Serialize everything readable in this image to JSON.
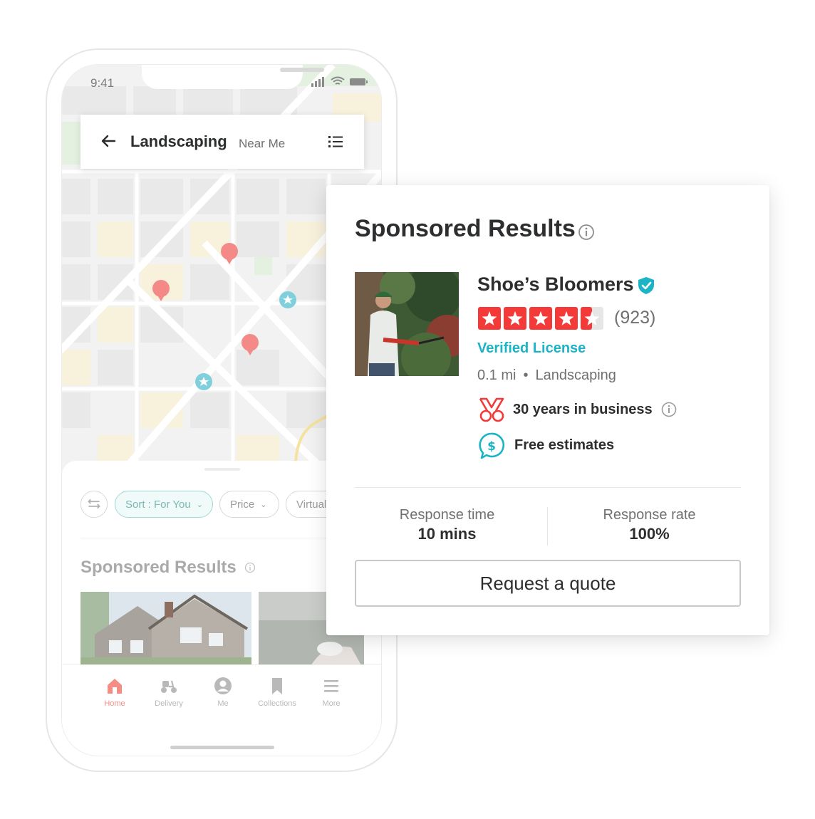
{
  "phone": {
    "status_time": "9:41",
    "search": {
      "title": "Landscaping",
      "subtitle": "Near Me"
    },
    "filters": {
      "sort_label": "Sort : For You",
      "price_label": "Price",
      "virtual_label": "Virtual"
    },
    "sponsored_title": "Sponsored Results",
    "tabs": [
      {
        "label": "Home",
        "icon": "home-icon",
        "active": true
      },
      {
        "label": "Delivery",
        "icon": "scooter-icon",
        "active": false
      },
      {
        "label": "Me",
        "icon": "user-icon",
        "active": false
      },
      {
        "label": "Collections",
        "icon": "bookmark-icon",
        "active": false
      },
      {
        "label": "More",
        "icon": "menu-icon",
        "active": false
      }
    ]
  },
  "card": {
    "title": "Sponsored Results",
    "business": {
      "name": "Shoe’s Bloomers",
      "rating": 4.5,
      "review_count": "(923)",
      "license": "Verified License",
      "distance": "0.1 mi",
      "separator": "•",
      "category": "Landscaping",
      "features": [
        {
          "icon": "award-icon",
          "text": "30 years in business"
        },
        {
          "icon": "dollar-chat-icon",
          "text": "Free estimates"
        }
      ]
    },
    "stats": [
      {
        "label": "Response time",
        "value": "10 mins"
      },
      {
        "label": "Response rate",
        "value": "100%"
      }
    ],
    "cta": "Request a quote"
  },
  "colors": {
    "star_red": "#f43939",
    "verified_teal": "#1bb3c6",
    "pin_red": "#f48a88",
    "pin_teal": "#7fd0dc",
    "tab_active": "#f58d85"
  }
}
